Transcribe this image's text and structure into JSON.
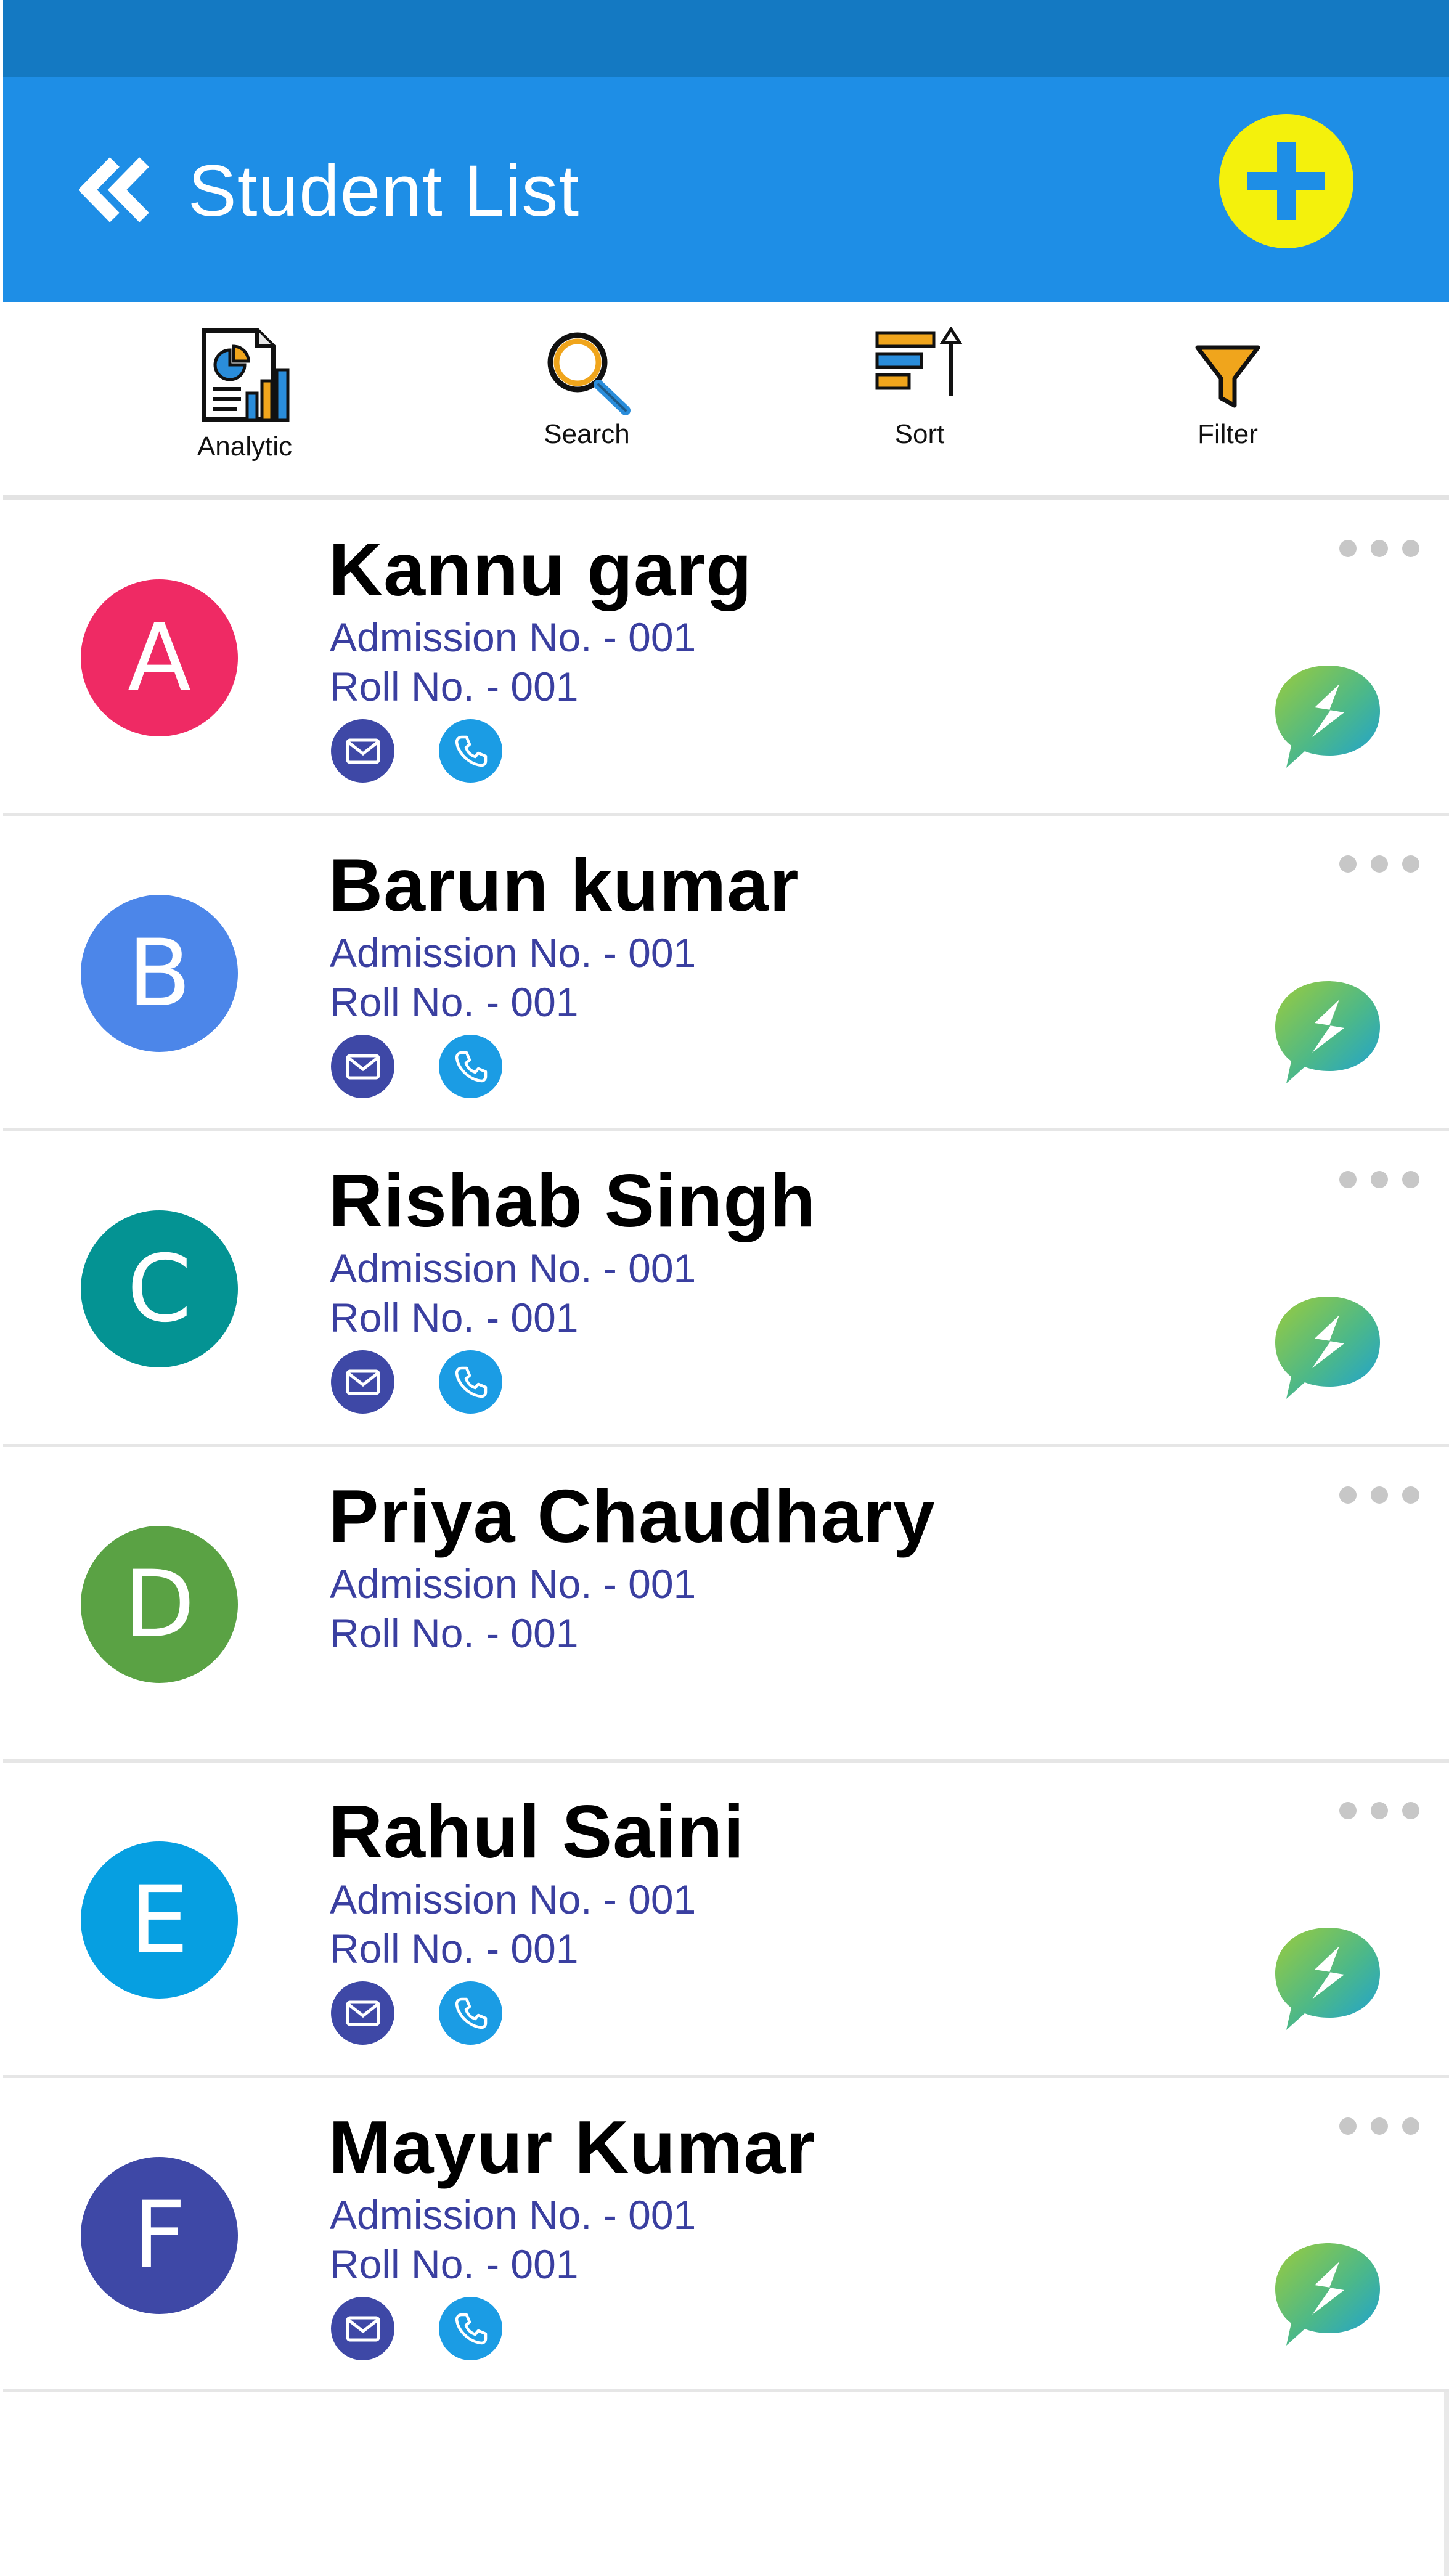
{
  "header": {
    "title": "Student List",
    "back_icon": "double-chevron-left-icon",
    "add_icon": "plus-icon",
    "colors": {
      "status_bar": "#1479c2",
      "bar": "#1e8ee6",
      "add_button": "#f4f10c",
      "plus": "#1e8ee6"
    }
  },
  "toolbar": {
    "analytic": {
      "label": "Analytic",
      "icon": "analytics-report-icon"
    },
    "search": {
      "label": "Search",
      "icon": "magnifier-icon"
    },
    "sort": {
      "label": "Sort",
      "icon": "sort-bars-icon"
    },
    "filter": {
      "label": "Filter",
      "icon": "funnel-icon"
    }
  },
  "students": [
    {
      "initial": "A",
      "name": "Kannu garg",
      "admission": "Admission No. - 001",
      "roll": "Roll No. - 001",
      "color": "#ef2a64",
      "contacts": true,
      "chat": true
    },
    {
      "initial": "B",
      "name": "Barun kumar",
      "admission": "Admission No. - 001",
      "roll": "Roll No. - 001",
      "color": "#4c86e9",
      "contacts": true,
      "chat": true
    },
    {
      "initial": "C",
      "name": "Rishab Singh",
      "admission": "Admission No. - 001",
      "roll": "Roll No. - 001",
      "color": "#049393",
      "contacts": true,
      "chat": true
    },
    {
      "initial": "D",
      "name": "Priya Chaudhary",
      "admission": "Admission No. - 001",
      "roll": "Roll No. - 001",
      "color": "#5aa244",
      "contacts": false,
      "chat": false
    },
    {
      "initial": "E",
      "name": "Rahul Saini",
      "admission": "Admission No. - 001",
      "roll": "Roll No. - 001",
      "color": "#069fe1",
      "contacts": true,
      "chat": true
    },
    {
      "initial": "F",
      "name": "Mayur Kumar",
      "admission": "Admission No. - 001",
      "roll": "Roll No. - 001",
      "color": "#3e48a6",
      "contacts": true,
      "chat": true
    }
  ],
  "row_icons": {
    "mail": "envelope-icon",
    "call": "phone-icon",
    "more": "more-dots-icon",
    "chat": "chat-bubble-icon"
  }
}
